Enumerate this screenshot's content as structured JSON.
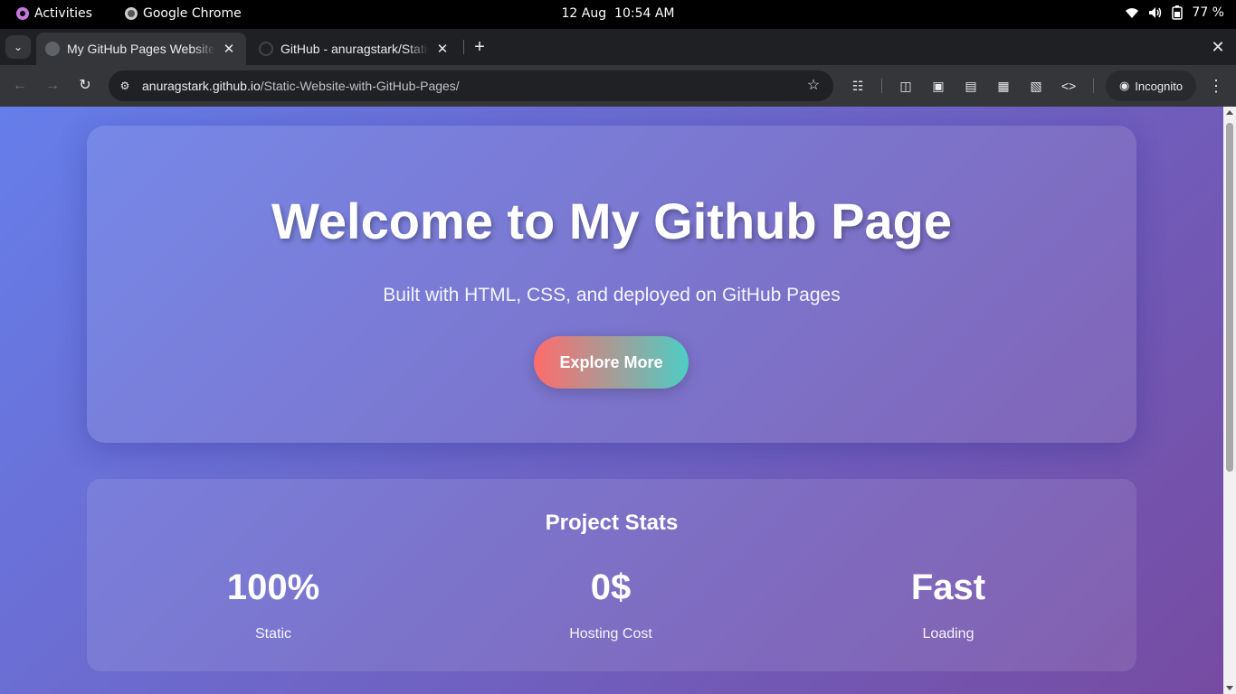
{
  "system_bar": {
    "activities_label": "Activities",
    "app_name": "Google Chrome",
    "date": "12 Aug",
    "time": "10:54 AM",
    "battery": "77 %"
  },
  "browser": {
    "tabs": [
      {
        "title": "My GitHub Pages Website",
        "active": true
      },
      {
        "title": "GitHub - anuragstark/Static-Website-with-GitHub-Pages",
        "active": false
      }
    ],
    "url_host": "anuragstark.github.io",
    "url_path": "/Static-Website-with-GitHub-Pages/",
    "profile_label": "Incognito"
  },
  "page": {
    "hero": {
      "title": "Welcome to My Github Page",
      "subtitle": "Built with HTML, CSS, and deployed on GitHub Pages",
      "cta_label": "Explore More"
    },
    "stats": {
      "heading": "Project Stats",
      "items": [
        {
          "value": "100%",
          "label": "Static"
        },
        {
          "value": "0$",
          "label": "Hosting Cost"
        },
        {
          "value": "Fast",
          "label": "Loading"
        }
      ]
    }
  },
  "colors": {
    "page_gradient_start": "#667eea",
    "page_gradient_end": "#764ba2",
    "cta_gradient_start": "#ff6b6b",
    "cta_gradient_end": "#4ecdc4"
  }
}
